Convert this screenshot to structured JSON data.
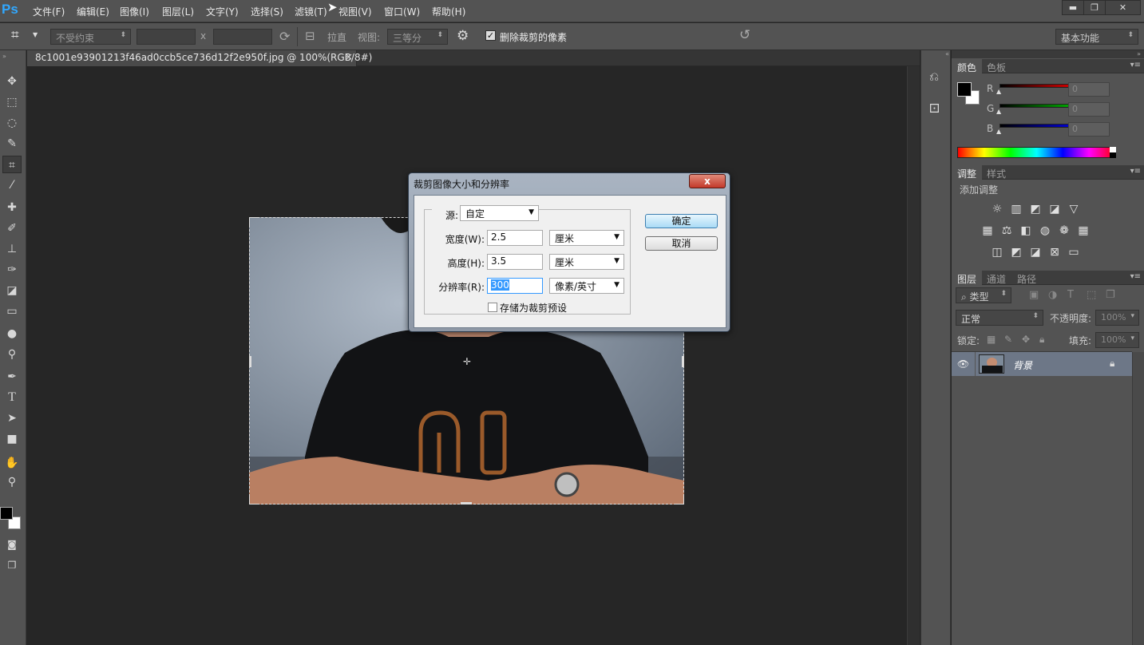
{
  "app": {
    "logo": "Ps"
  },
  "menu": [
    "文件(F)",
    "编辑(E)",
    "图像(I)",
    "图层(L)",
    "文字(Y)",
    "选择(S)",
    "滤镜(T)",
    "视图(V)",
    "窗口(W)",
    "帮助(H)"
  ],
  "window_buttons": {
    "minimize": "▬",
    "restore": "❐",
    "close": "✕"
  },
  "options": {
    "ratio": "不受约束",
    "x_sep": "x",
    "straighten": "拉直",
    "view_label": "视图:",
    "view_value": "三等分",
    "delete_cropped_label": "删除裁剪的像素",
    "delete_cropped_checked": true,
    "workspace": "基本功能"
  },
  "document": {
    "tab_title": "8c1001e93901213f46ad0ccb5ce736d12f2e950f.jpg @ 100%(RGB/8#)",
    "tab_close": "×"
  },
  "tools": [
    "move-tool-icon",
    "marquee-tool-icon",
    "lasso-tool-icon",
    "quick-select-tool-icon",
    "crop-tool-icon",
    "eyedropper-tool-icon",
    "healing-brush-icon",
    "brush-tool-icon",
    "clone-stamp-icon",
    "history-brush-icon",
    "eraser-tool-icon",
    "gradient-tool-icon",
    "blur-tool-icon",
    "dodge-tool-icon",
    "pen-tool-icon",
    "type-tool-icon",
    "path-select-icon",
    "shape-tool-icon",
    "hand-tool-icon",
    "zoom-tool-icon"
  ],
  "color_panel": {
    "tabs": [
      "颜色",
      "色板"
    ],
    "channels": [
      {
        "label": "R",
        "value": "0",
        "color": "#ff0000"
      },
      {
        "label": "G",
        "value": "0",
        "color": "#00cc00"
      },
      {
        "label": "B",
        "value": "0",
        "color": "#0000ff"
      }
    ]
  },
  "adjust_panel": {
    "tabs": [
      "调整",
      "样式"
    ],
    "title": "添加调整"
  },
  "layers_panel": {
    "tabs": [
      "图层",
      "通道",
      "路径"
    ],
    "filter_kind": "类型",
    "blend_mode": "正常",
    "opacity_label": "不透明度:",
    "opacity_value": "100%",
    "lock_label": "锁定:",
    "fill_label": "填充:",
    "fill_value": "100%",
    "layers": [
      {
        "name": "背景",
        "visible": true,
        "locked": true
      }
    ]
  },
  "dialog": {
    "title": "裁剪图像大小和分辨率",
    "close": "x",
    "source_label": "源:",
    "source_value": "自定",
    "width_label": "宽度(W):",
    "width_value": "2.5",
    "width_unit": "厘米",
    "height_label": "高度(H):",
    "height_value": "3.5",
    "height_unit": "厘米",
    "resolution_label": "分辨率(R):",
    "resolution_value": "300",
    "resolution_unit": "像素/英寸",
    "save_preset_label": "存储为裁剪预设",
    "ok": "确定",
    "cancel": "取消"
  }
}
